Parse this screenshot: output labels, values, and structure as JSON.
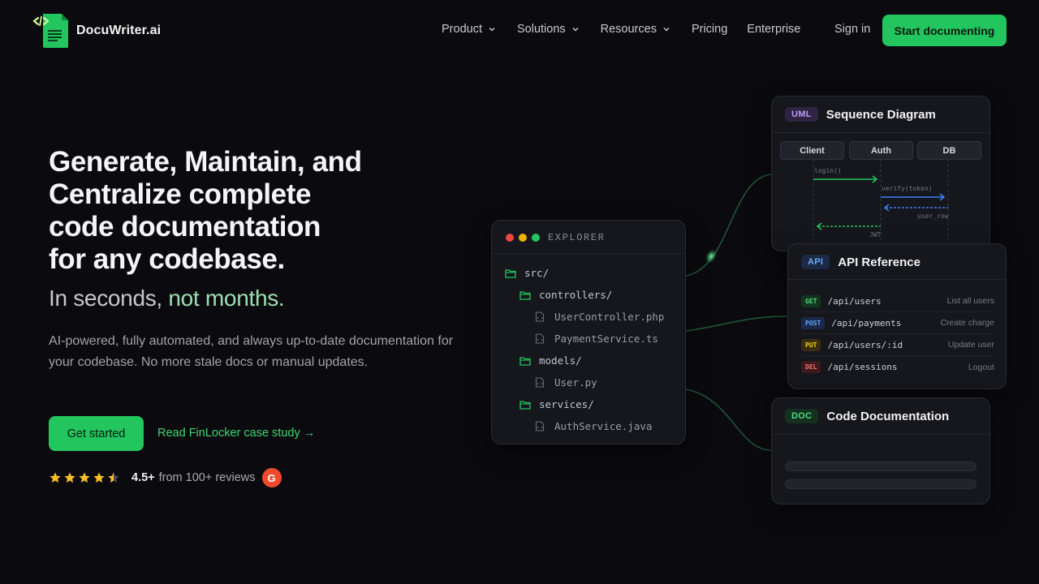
{
  "brand": {
    "name": "DocuWriter.ai"
  },
  "nav": {
    "items": [
      {
        "label": "Product",
        "dropdown": true
      },
      {
        "label": "Solutions",
        "dropdown": true
      },
      {
        "label": "Resources",
        "dropdown": true
      },
      {
        "label": "Pricing",
        "dropdown": false
      },
      {
        "label": "Enterprise",
        "dropdown": false
      }
    ],
    "signin": "Sign in",
    "cta": "Start documenting"
  },
  "hero": {
    "title_lines": [
      "Generate, Maintain, and",
      "Centralize complete",
      "code documentation",
      "for any codebase."
    ],
    "subtitle_plain": "In seconds, ",
    "subtitle_accent": "not months.",
    "description": "AI-powered, fully automated, and always up-to-date documentation for your codebase. No more stale docs or manual updates.",
    "primary_button": "Get started",
    "secondary_link": "Read FinLocker case study →",
    "rating": {
      "stars": 4.5,
      "score": "4.5+",
      "text": "from 100+ reviews",
      "badge": "G"
    }
  },
  "explorer": {
    "title": "EXPLORER",
    "tree": [
      {
        "type": "folder",
        "name": "src/",
        "depth": 0
      },
      {
        "type": "folder",
        "name": "controllers/",
        "depth": 1
      },
      {
        "type": "file",
        "name": "UserController.php",
        "depth": 2
      },
      {
        "type": "file",
        "name": "PaymentService.ts",
        "depth": 2
      },
      {
        "type": "folder",
        "name": "models/",
        "depth": 1
      },
      {
        "type": "file",
        "name": "User.py",
        "depth": 2
      },
      {
        "type": "folder",
        "name": "services/",
        "depth": 1
      },
      {
        "type": "file",
        "name": "AuthService.java",
        "depth": 2
      }
    ]
  },
  "uml": {
    "tag": "UML",
    "title": "Sequence Diagram",
    "actors": [
      "Client",
      "Auth",
      "DB"
    ],
    "messages": [
      "login()",
      "verify(token)",
      "user_row",
      "JWT"
    ]
  },
  "api": {
    "tag": "API",
    "title": "API Reference",
    "endpoints": [
      {
        "method": "GET",
        "path": "/api/users",
        "desc": "List all users"
      },
      {
        "method": "POST",
        "path": "/api/payments",
        "desc": "Create charge"
      },
      {
        "method": "PUT",
        "path": "/api/users/:id",
        "desc": "Update user"
      },
      {
        "method": "DEL",
        "path": "/api/sessions",
        "desc": "Logout"
      }
    ]
  },
  "doc": {
    "tag": "DOC",
    "title": "Code Documentation"
  },
  "colors": {
    "accent": "#22c55e",
    "background": "#0b0b0f",
    "card": "#16161d",
    "uml_tag": "#a78bfa",
    "api_tag": "#60a5fa",
    "doc_tag": "#4ade80"
  }
}
